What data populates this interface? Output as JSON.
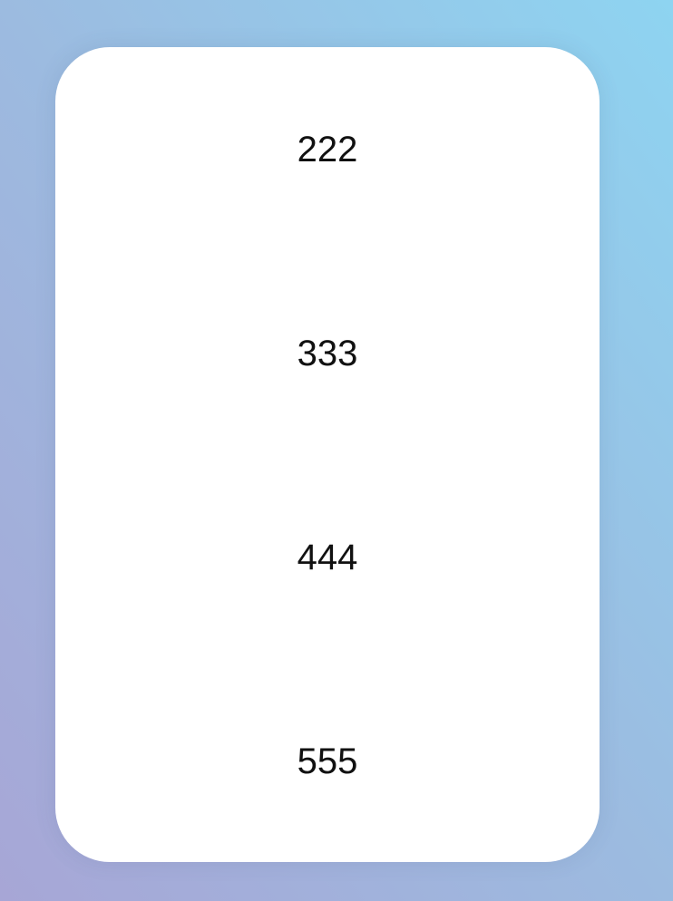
{
  "picker": {
    "items": [
      "222",
      "333",
      "444",
      "555"
    ]
  },
  "colors": {
    "background_top_right": "#8ed4f1",
    "background_bottom_left": "#a7a6d6",
    "card": "#ffffff",
    "text": "#111111"
  }
}
